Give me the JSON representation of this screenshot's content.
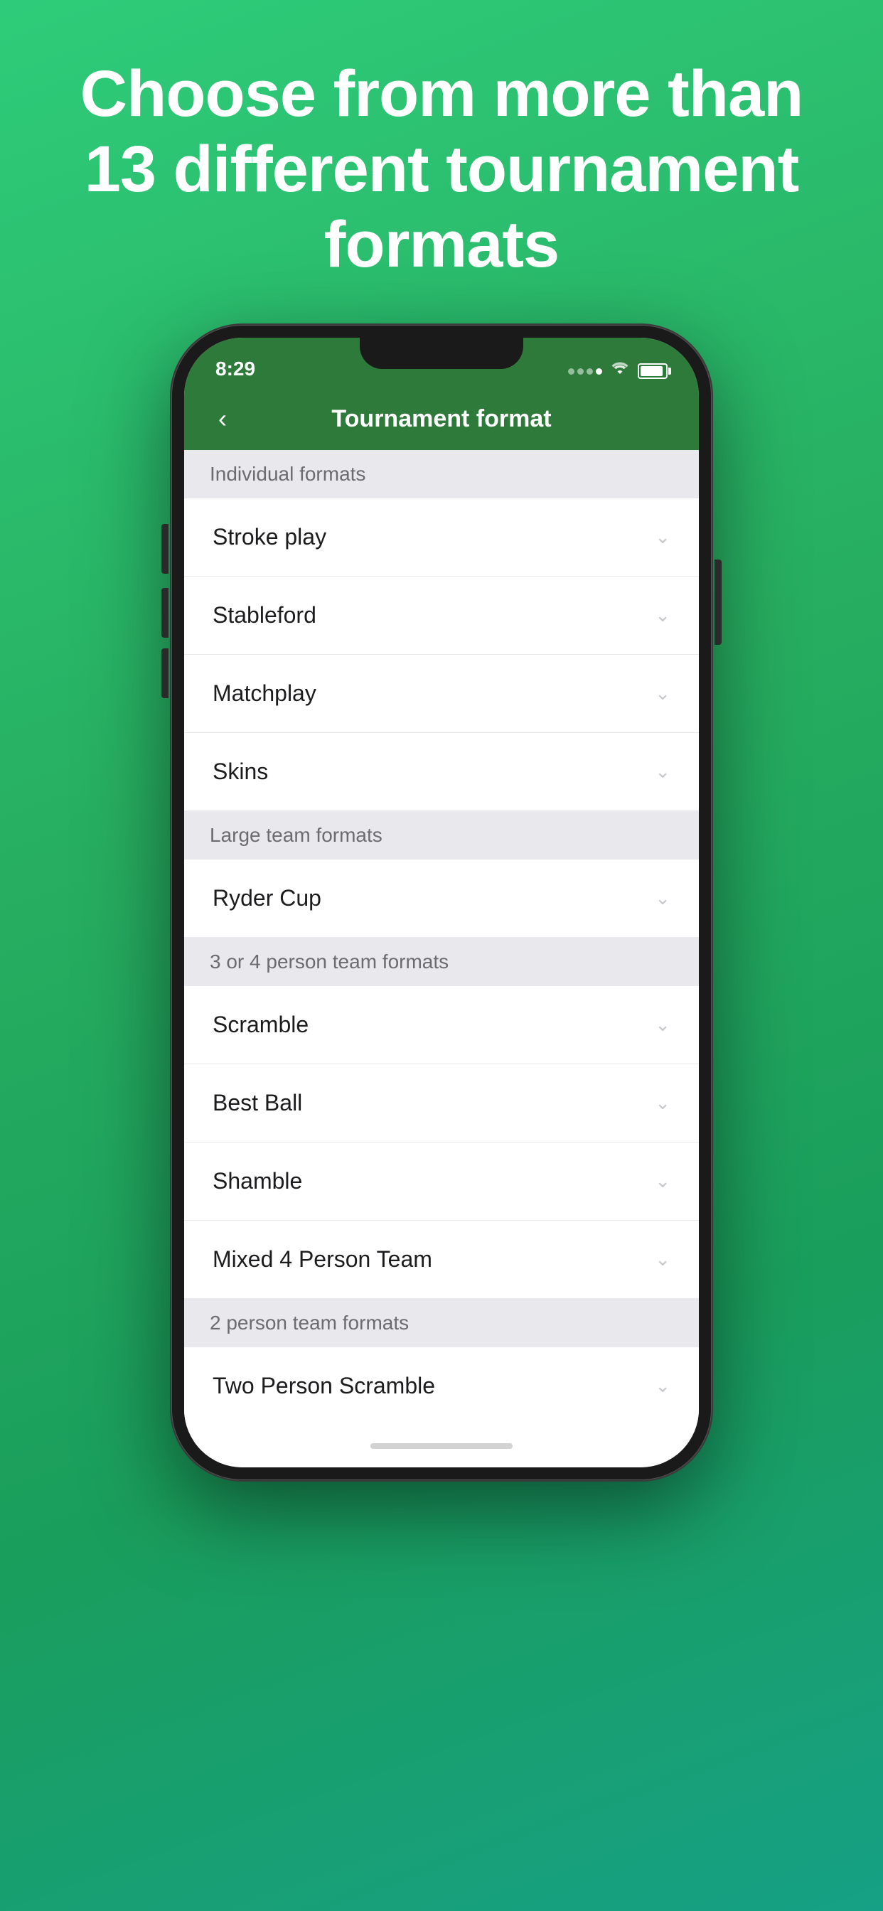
{
  "hero": {
    "title": "Choose from more than 13 different tournament formats"
  },
  "statusBar": {
    "time": "8:29"
  },
  "navBar": {
    "title": "Tournament format",
    "backLabel": "‹"
  },
  "sections": [
    {
      "id": "individual",
      "header": "Individual formats",
      "items": [
        {
          "id": "stroke-play",
          "label": "Stroke play"
        },
        {
          "id": "stableford",
          "label": "Stableford"
        },
        {
          "id": "matchplay",
          "label": "Matchplay"
        },
        {
          "id": "skins",
          "label": "Skins"
        }
      ]
    },
    {
      "id": "large-team",
      "header": "Large team formats",
      "items": [
        {
          "id": "ryder-cup",
          "label": "Ryder Cup"
        }
      ]
    },
    {
      "id": "3or4-person",
      "header": "3 or 4 person team formats",
      "items": [
        {
          "id": "scramble",
          "label": "Scramble"
        },
        {
          "id": "best-ball",
          "label": "Best Ball"
        },
        {
          "id": "shamble",
          "label": "Shamble"
        },
        {
          "id": "mixed-4-person",
          "label": "Mixed 4 Person Team"
        }
      ]
    },
    {
      "id": "2-person",
      "header": "2 person team formats",
      "items": [
        {
          "id": "two-person-scramble",
          "label": "Two Person Scramble"
        }
      ]
    }
  ]
}
